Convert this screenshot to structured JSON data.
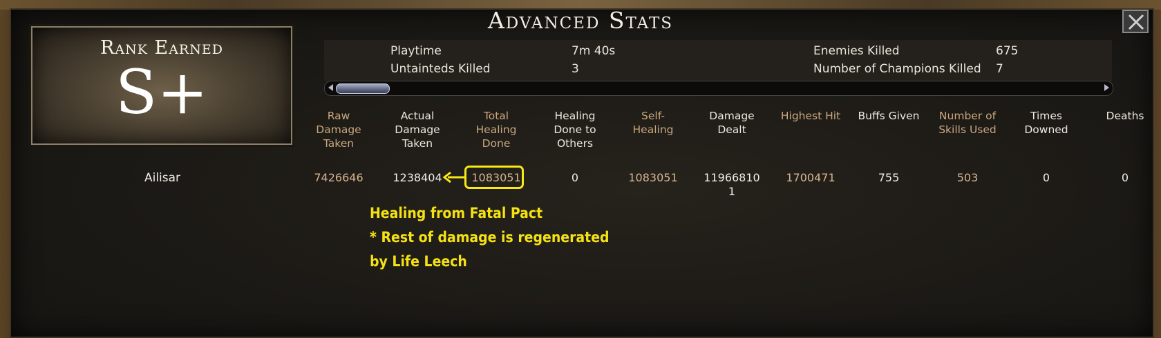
{
  "window": {
    "title": "Advanced Stats"
  },
  "rank": {
    "label": "Rank Earned",
    "value": "S+"
  },
  "summary": {
    "playtime_label": "Playtime",
    "playtime_value": "7m 40s",
    "untainteds_label": "Untainteds Killed",
    "untainteds_value": "3",
    "enemies_label": "Enemies Killed",
    "enemies_value": "675",
    "champions_label": "Number of Champions Killed",
    "champions_value": "7"
  },
  "table": {
    "columns": [
      "Raw Damage Taken",
      "Actual Damage Taken",
      "Total Healing Done",
      "Healing Done to Others",
      "Self-Healing",
      "Damage Dealt",
      "Highest Hit",
      "Buffs Given",
      "Number of Skills Used",
      "Times Downed",
      "Deaths"
    ],
    "columns_display": [
      [
        "Raw",
        "Damage",
        "Taken"
      ],
      [
        "Actual",
        "Damage",
        "Taken"
      ],
      [
        "Total",
        "Healing",
        "Done"
      ],
      [
        "Healing",
        "Done to",
        "Others"
      ],
      [
        "Self-",
        "Healing"
      ],
      [
        "Damage",
        "Dealt"
      ],
      [
        "Highest Hit"
      ],
      [
        "Buffs Given"
      ],
      [
        "Number of",
        "Skills Used"
      ],
      [
        "Times",
        "Downed"
      ],
      [
        "Deaths"
      ]
    ],
    "rows": [
      {
        "player": "Ailisar",
        "values": [
          "7426646",
          "1238404",
          "1083051",
          "0",
          "1083051",
          "119668101",
          "1700471",
          "755",
          "503",
          "0",
          "0"
        ],
        "values_display": [
          "7426646",
          "1238404",
          "1083051",
          "0",
          "1083051",
          [
            "11966810",
            "1"
          ],
          "1700471",
          "755",
          "503",
          "0",
          "0"
        ]
      }
    ]
  },
  "annotation": {
    "lines": [
      "Healing from Fatal Pact",
      "* Rest of damage is regenerated",
      "by Life Leech"
    ]
  },
  "colors": {
    "header_gold": "#c9a77e",
    "header_white": "#ece8de",
    "annotation_yellow": "#f5e212",
    "background": "#1b1915"
  },
  "icons": {
    "close": "close-x-icon",
    "scroll_left": "triangle-left-icon",
    "scroll_right": "triangle-right-icon"
  }
}
